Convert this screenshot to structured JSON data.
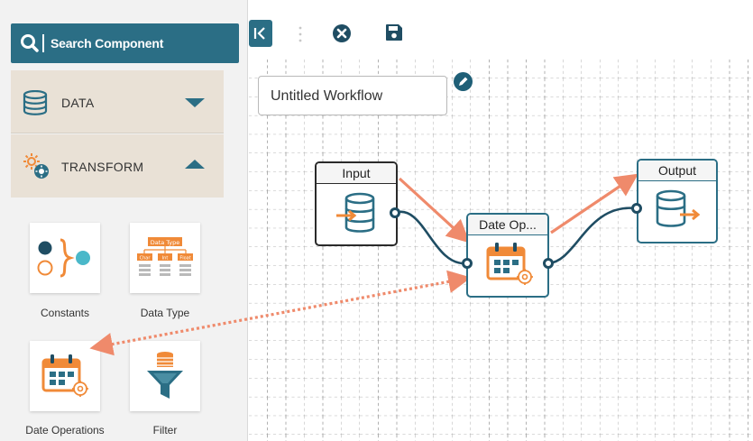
{
  "sidebar": {
    "search_label": "Search Component",
    "categories": [
      {
        "label": "DATA",
        "state": "collapsed",
        "icon": "database-icon"
      },
      {
        "label": "TRANSFORM",
        "state": "expanded",
        "icon": "gears-icon"
      }
    ],
    "components": [
      {
        "label": "Constants",
        "icon": "constants-icon"
      },
      {
        "label": "Data Type",
        "icon": "data-type-icon"
      },
      {
        "label": "Date Operations",
        "icon": "calendar-gear-icon"
      },
      {
        "label": "Filter",
        "icon": "filter-funnel-icon"
      }
    ],
    "data_type_tile_text": {
      "header": "Data Type",
      "cells": [
        "Char",
        "Int",
        "Float"
      ]
    }
  },
  "toolbar": {
    "collapse_icon": "collapse-left-icon",
    "close_icon": "close-circle-icon",
    "save_icon": "save-icon"
  },
  "workflow": {
    "title": "Untitled Workflow",
    "edit_icon": "pencil-icon"
  },
  "nodes": [
    {
      "title": "Input",
      "icon": "database-in-icon"
    },
    {
      "title": "Date Op...",
      "icon": "calendar-gear-icon"
    },
    {
      "title": "Output",
      "icon": "database-out-icon"
    }
  ],
  "colors": {
    "accent": "#2b6e85",
    "category_bg": "#e9e1d6",
    "orange": "#f08a38",
    "arrow_salmon": "#ef8a6b",
    "connector": "#1f4d63"
  }
}
